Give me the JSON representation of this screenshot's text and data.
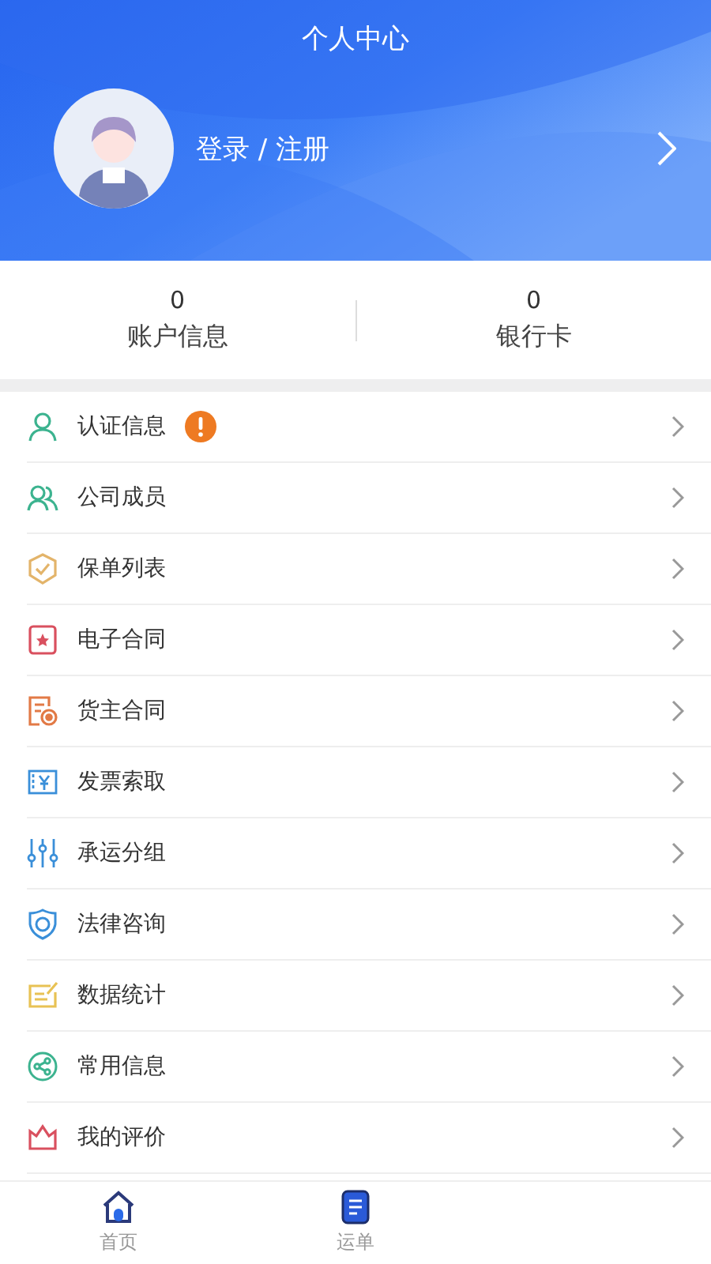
{
  "header": {
    "title": "个人中心",
    "login": "登录 / 注册"
  },
  "stats": [
    {
      "value": "0",
      "label": "账户信息"
    },
    {
      "value": "0",
      "label": "银行卡"
    }
  ],
  "menu": [
    {
      "kind": "person",
      "label": "认证信息",
      "alert": true
    },
    {
      "kind": "people",
      "label": "公司成员",
      "alert": false
    },
    {
      "kind": "shield",
      "label": "保单列表",
      "alert": false
    },
    {
      "kind": "contract",
      "label": "电子合同",
      "alert": false
    },
    {
      "kind": "document",
      "label": "货主合同",
      "alert": false
    },
    {
      "kind": "invoice",
      "label": "发票索取",
      "alert": false
    },
    {
      "kind": "sliders",
      "label": "承运分组",
      "alert": false
    },
    {
      "kind": "law",
      "label": "法律咨询",
      "alert": false
    },
    {
      "kind": "note",
      "label": "数据统计",
      "alert": false
    },
    {
      "kind": "share",
      "label": "常用信息",
      "alert": false
    },
    {
      "kind": "crown",
      "label": "我的评价",
      "alert": false
    }
  ],
  "tabbar": [
    {
      "kind": "home",
      "label": "首页"
    },
    {
      "kind": "orders",
      "label": "运单"
    }
  ]
}
